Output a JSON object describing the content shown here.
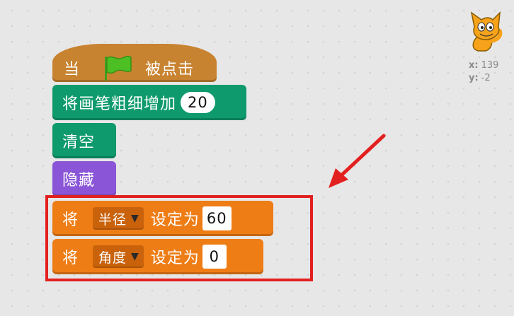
{
  "script": {
    "hat": {
      "when_label": "当",
      "clicked_label": "被点击",
      "icon": "green-flag-icon"
    },
    "pen_block": {
      "label": "将画笔粗细增加",
      "value": "20"
    },
    "clear_block": {
      "label": "清空"
    },
    "hide_block": {
      "label": "隐藏"
    },
    "set_radius": {
      "prefix": "将",
      "variable": "半径",
      "mid": "设定为",
      "value": "60"
    },
    "set_angle": {
      "prefix": "将",
      "variable": "角度",
      "mid": "设定为",
      "value": "0"
    }
  },
  "sprite_info": {
    "icon": "cat-sprite-icon",
    "x_label": "x:",
    "x_value": "139",
    "y_label": "y:",
    "y_value": "-2"
  },
  "colors": {
    "events": "#c88330",
    "pen": "#0e9a6c",
    "looks": "#8a55d7",
    "data": "#ee7d16",
    "highlight": "#e32020",
    "arrow": "#e32020"
  }
}
